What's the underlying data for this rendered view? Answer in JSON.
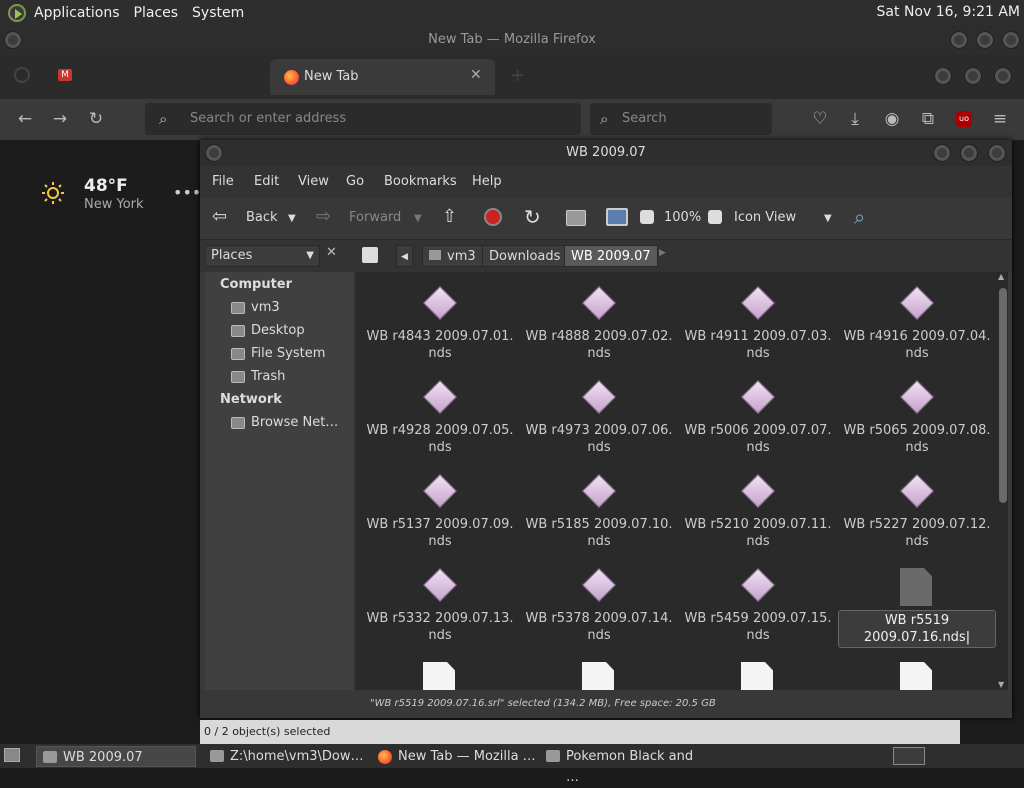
{
  "top_panel": {
    "menus": [
      "Applications",
      "Places",
      "System"
    ],
    "clock": "Sat Nov 16,  9:21 AM"
  },
  "firefox": {
    "title": "New Tab — Mozilla Firefox",
    "tabs": [
      {
        "label": "Gmail"
      },
      {
        "label": "New Tab"
      }
    ],
    "url_placeholder": "Search or enter address",
    "search_placeholder": "Search",
    "weather": {
      "temp": "48°F",
      "location": "New York"
    },
    "status": "0 / 2 object(s) selected"
  },
  "filemanager": {
    "title": "WB 2009.07",
    "menu": [
      "File",
      "Edit",
      "View",
      "Go",
      "Bookmarks",
      "Help"
    ],
    "toolbar": {
      "back": "Back",
      "forward": "Forward",
      "zoom": "100%",
      "view_mode": "Icon View"
    },
    "sidebar_combo": "Places",
    "breadcrumbs": [
      "vm3",
      "Downloads",
      "WB 2009.07"
    ],
    "sidebar": {
      "computer_header": "Computer",
      "computer_items": [
        "vm3",
        "Desktop",
        "File System",
        "Trash"
      ],
      "network_header": "Network",
      "network_items": [
        "Browse Net…"
      ]
    },
    "files": [
      {
        "l1": "WB r4843 2009.07.01.",
        "l2": "nds"
      },
      {
        "l1": "WB r4888 2009.07.02.",
        "l2": "nds"
      },
      {
        "l1": "WB r4911 2009.07.03.",
        "l2": "nds"
      },
      {
        "l1": "WB r4916 2009.07.04.",
        "l2": "nds"
      },
      {
        "l1": "WB r4928 2009.07.05.",
        "l2": "nds"
      },
      {
        "l1": "WB r4973 2009.07.06.",
        "l2": "nds"
      },
      {
        "l1": "WB r5006 2009.07.07.",
        "l2": "nds"
      },
      {
        "l1": "WB r5065 2009.07.08.",
        "l2": "nds"
      },
      {
        "l1": "WB r5137 2009.07.09.",
        "l2": "nds"
      },
      {
        "l1": "WB r5185 2009.07.10.",
        "l2": "nds"
      },
      {
        "l1": "WB r5210 2009.07.11.",
        "l2": "nds"
      },
      {
        "l1": "WB r5227 2009.07.12.",
        "l2": "nds"
      },
      {
        "l1": "WB r5332 2009.07.13.",
        "l2": "nds"
      },
      {
        "l1": "WB r5378 2009.07.14.",
        "l2": "nds"
      },
      {
        "l1": "WB r5459 2009.07.15.",
        "l2": "nds"
      },
      {
        "l1": "WB r5519",
        "l2": "2009.07.16.nds"
      }
    ],
    "status": "\"WB r5519 2009.07.16.srl\" selected (134.2 MB), Free space: 20.5 GB"
  },
  "taskbar": [
    "WB 2009.07",
    "Z:\\home\\vm3\\Dow…",
    "New Tab — Mozilla …",
    "Pokemon Black and …"
  ]
}
